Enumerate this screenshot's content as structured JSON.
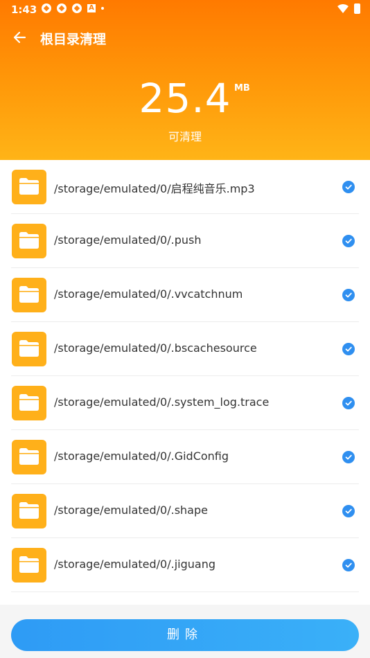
{
  "status_bar": {
    "time": "1:43"
  },
  "header": {
    "title": "根目录清理",
    "size_value": "25.4",
    "size_unit": "MB",
    "size_caption": "可清理"
  },
  "colors": {
    "header_top": "#ff7a00",
    "header_bottom": "#ffb417",
    "folder": "#ffb01a",
    "check": "#2f8ff0",
    "button": "#2e9bf5"
  },
  "files": [
    {
      "path": "/storage/emulated/0/启程纯音乐.mp3",
      "checked": true
    },
    {
      "path": "/storage/emulated/0/.push",
      "checked": true
    },
    {
      "path": "/storage/emulated/0/.vvcatchnum",
      "checked": true
    },
    {
      "path": "/storage/emulated/0/.bscachesource",
      "checked": true
    },
    {
      "path": "/storage/emulated/0/.system_log.trace",
      "checked": true
    },
    {
      "path": "/storage/emulated/0/.GidConfig",
      "checked": true
    },
    {
      "path": "/storage/emulated/0/.shape",
      "checked": true
    },
    {
      "path": "/storage/emulated/0/.jiguang",
      "checked": true
    }
  ],
  "footer": {
    "delete_label": "删除"
  }
}
